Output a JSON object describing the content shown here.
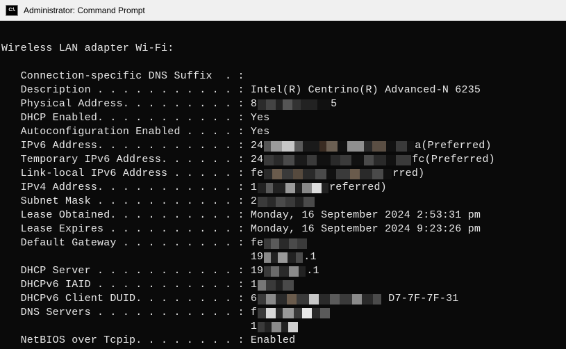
{
  "titlebar": {
    "icon_text": "C:\\.",
    "title": "Administrator: Command Prompt"
  },
  "section_heading": "Wireless LAN adapter Wi-Fi:",
  "rows": [
    {
      "label": "   Connection-specific DNS Suffix  . :",
      "value": ""
    },
    {
      "label": "   Description . . . . . . . . . . . :",
      "value": " Intel(R) Centrino(R) Advanced-N 6235"
    },
    {
      "label": "   Physical Address. . . . . . . . . :",
      "value": " 8",
      "redact": "phys",
      "suffix": "5"
    },
    {
      "label": "   DHCP Enabled. . . . . . . . . . . :",
      "value": " Yes"
    },
    {
      "label": "   Autoconfiguration Enabled . . . . :",
      "value": " Yes"
    },
    {
      "label": "   IPv6 Address. . . . . . . . . . . :",
      "value": " 24",
      "redact": "ipv6a",
      "suffix": "a(Preferred)"
    },
    {
      "label": "   Temporary IPv6 Address. . . . . . :",
      "value": " 24",
      "redact": "ipv6b",
      "suffix": "fc(Preferred)"
    },
    {
      "label": "   Link-local IPv6 Address . . . . . :",
      "value": " fe",
      "redact": "ll",
      "suffix": "rred)"
    },
    {
      "label": "   IPv4 Address. . . . . . . . . . . :",
      "value": " 1",
      "redact": "ipv4",
      "suffix": "referred)"
    },
    {
      "label": "   Subnet Mask . . . . . . . . . . . :",
      "value": " 2",
      "redact": "subnet",
      "suffix": ""
    },
    {
      "label": "   Lease Obtained. . . . . . . . . . :",
      "value": " Monday, 16 September 2024 2:53:31 pm"
    },
    {
      "label": "   Lease Expires . . . . . . . . . . :",
      "value": " Monday, 16 September 2024 9:23:26 pm"
    },
    {
      "label": "   Default Gateway . . . . . . . . . :",
      "value": " fe",
      "redact": "gw",
      "suffix": ""
    },
    {
      "label": "                                      ",
      "value": " 19",
      "redact": "gw2",
      "suffix": ".1"
    },
    {
      "label": "   DHCP Server . . . . . . . . . . . :",
      "value": " 19",
      "redact": "dhcp",
      "suffix": ".1"
    },
    {
      "label": "   DHCPv6 IAID . . . . . . . . . . . :",
      "value": " 1",
      "redact": "iaid",
      "suffix": ""
    },
    {
      "label": "   DHCPv6 Client DUID. . . . . . . . :",
      "value": " 6",
      "redact": "duid",
      "suffix": " D7-7F-7F-31"
    },
    {
      "label": "   DNS Servers . . . . . . . . . . . :",
      "value": " f",
      "redact": "dns1",
      "suffix": ""
    },
    {
      "label": "                                      ",
      "value": " 1",
      "redact": "dns2",
      "suffix": ""
    },
    {
      "label": "   NetBIOS over Tcpip. . . . . . . . :",
      "value": " Enabled"
    }
  ],
  "redactions": {
    "phys": [
      [
        12,
        "#2b2b2b"
      ],
      [
        14,
        "#444"
      ],
      [
        10,
        "#222"
      ],
      [
        14,
        "#555"
      ],
      [
        12,
        "#333"
      ],
      [
        10,
        "#222"
      ],
      [
        14,
        "#222"
      ],
      [
        18,
        "#111"
      ]
    ],
    "ipv6a": [
      [
        10,
        "#555"
      ],
      [
        16,
        "#9b9b9b"
      ],
      [
        18,
        "#c7c7c7"
      ],
      [
        12,
        "#5a5a5a"
      ],
      [
        24,
        "#1a1a1a"
      ],
      [
        10,
        "#3a2c22"
      ],
      [
        16,
        "#6b5f52"
      ],
      [
        14,
        "#111"
      ],
      [
        24,
        "#8f8f8f"
      ],
      [
        12,
        "#2a2a2a"
      ],
      [
        20,
        "#5a4e43"
      ],
      [
        14,
        "#111"
      ],
      [
        16,
        "#3a3a3a"
      ],
      [
        10,
        "#111"
      ]
    ],
    "ipv6b": [
      [
        14,
        "#3a3a3a"
      ],
      [
        14,
        "#2a2a2a"
      ],
      [
        16,
        "#4a4a4a"
      ],
      [
        18,
        "#1a1a1a"
      ],
      [
        14,
        "#3a3a3a"
      ],
      [
        20,
        "#111"
      ],
      [
        14,
        "#2a2a2a"
      ],
      [
        16,
        "#3a3a3a"
      ],
      [
        18,
        "#111"
      ],
      [
        14,
        "#4a4a4a"
      ],
      [
        18,
        "#2a2a2a"
      ],
      [
        14,
        "#111"
      ],
      [
        22,
        "#3a3a3a"
      ]
    ],
    "ll": [
      [
        12,
        "#2a2a2a"
      ],
      [
        14,
        "#6a5b4c"
      ],
      [
        16,
        "#3a3a3a"
      ],
      [
        14,
        "#564a3e"
      ],
      [
        18,
        "#2a2a2a"
      ],
      [
        16,
        "#4a4a4a"
      ],
      [
        14,
        "#111"
      ],
      [
        20,
        "#3a3a3a"
      ],
      [
        14,
        "#6a5b4c"
      ],
      [
        18,
        "#2a2a2a"
      ],
      [
        16,
        "#4a4a4a"
      ],
      [
        12,
        "#111"
      ]
    ],
    "ipv4": [
      [
        12,
        "#222"
      ],
      [
        10,
        "#5a5a5a"
      ],
      [
        18,
        "#222"
      ],
      [
        14,
        "#9a9a9a"
      ],
      [
        10,
        "#222"
      ],
      [
        14,
        "#888"
      ],
      [
        14,
        "#ddd"
      ],
      [
        10,
        "#222"
      ]
    ],
    "subnet": [
      [
        14,
        "#3a3a3a"
      ],
      [
        12,
        "#2a2a2a"
      ],
      [
        14,
        "#4a4a4a"
      ],
      [
        14,
        "#3a3a3a"
      ],
      [
        12,
        "#222"
      ],
      [
        16,
        "#4a4a4a"
      ]
    ],
    "gw": [
      [
        10,
        "#3a3a3a"
      ],
      [
        12,
        "#5a5a5a"
      ],
      [
        14,
        "#2a2a2a"
      ],
      [
        12,
        "#4a4a4a"
      ],
      [
        14,
        "#3a3a3a"
      ]
    ],
    "gw2": [
      [
        10,
        "#888"
      ],
      [
        10,
        "#222"
      ],
      [
        14,
        "#9a9a9a"
      ],
      [
        12,
        "#222"
      ],
      [
        10,
        "#4a4a4a"
      ]
    ],
    "dhcp": [
      [
        10,
        "#3a3a3a"
      ],
      [
        12,
        "#6a6a6a"
      ],
      [
        14,
        "#2a2a2a"
      ],
      [
        14,
        "#8a8a8a"
      ],
      [
        10,
        "#222"
      ]
    ],
    "iaid": [
      [
        12,
        "#777"
      ],
      [
        14,
        "#3a3a3a"
      ],
      [
        10,
        "#222"
      ],
      [
        16,
        "#4a4a4a"
      ]
    ],
    "duid": [
      [
        12,
        "#3a3a3a"
      ],
      [
        14,
        "#8a8a8a"
      ],
      [
        16,
        "#2a2a2a"
      ],
      [
        14,
        "#6a5b4c"
      ],
      [
        18,
        "#3a3a3a"
      ],
      [
        14,
        "#c7c7c7"
      ],
      [
        16,
        "#2a2a2a"
      ],
      [
        14,
        "#5a5a5a"
      ],
      [
        18,
        "#3a3a3a"
      ],
      [
        14,
        "#8a8a8a"
      ],
      [
        16,
        "#2a2a2a"
      ],
      [
        12,
        "#4a4a4a"
      ]
    ],
    "dns1": [
      [
        12,
        "#3a3a3a"
      ],
      [
        14,
        "#d8d8d8"
      ],
      [
        10,
        "#2a2a2a"
      ],
      [
        16,
        "#9a9a9a"
      ],
      [
        12,
        "#3a3a3a"
      ],
      [
        14,
        "#e8e8e8"
      ],
      [
        12,
        "#2a2a2a"
      ],
      [
        14,
        "#5a5a5a"
      ]
    ],
    "dns2": [
      [
        10,
        "#3a3a3a"
      ],
      [
        10,
        "#222"
      ],
      [
        14,
        "#8a8a8a"
      ],
      [
        10,
        "#222"
      ],
      [
        14,
        "#d0d0d0"
      ]
    ]
  }
}
